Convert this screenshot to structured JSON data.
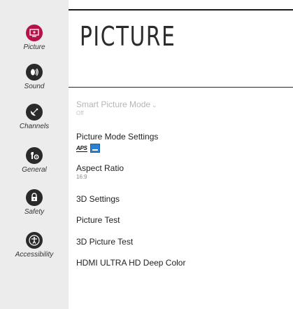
{
  "sidebar": {
    "items": [
      {
        "label": "Picture",
        "icon": "picture-icon"
      },
      {
        "label": "Sound",
        "icon": "sound-icon"
      },
      {
        "label": "Channels",
        "icon": "channels-icon"
      },
      {
        "label": "General",
        "icon": "general-icon"
      },
      {
        "label": "Safety",
        "icon": "safety-icon"
      },
      {
        "label": "Accessibility",
        "icon": "accessibility-icon"
      }
    ],
    "active_color": "#b5124a"
  },
  "page": {
    "title": "PICTURE"
  },
  "menu": {
    "smart_picture_mode": {
      "label": "Smart Picture Mode",
      "value": "Off"
    },
    "picture_mode_settings": {
      "label": "Picture Mode Settings",
      "logo_text": "APS"
    },
    "aspect_ratio": {
      "label": "Aspect Ratio",
      "value": "16:9"
    },
    "settings_3d": {
      "label": "3D Settings"
    },
    "picture_test": {
      "label": "Picture Test"
    },
    "picture_test_3d": {
      "label": "3D Picture Test"
    },
    "hdmi_deep_color": {
      "label": "HDMI ULTRA HD Deep Color"
    }
  }
}
